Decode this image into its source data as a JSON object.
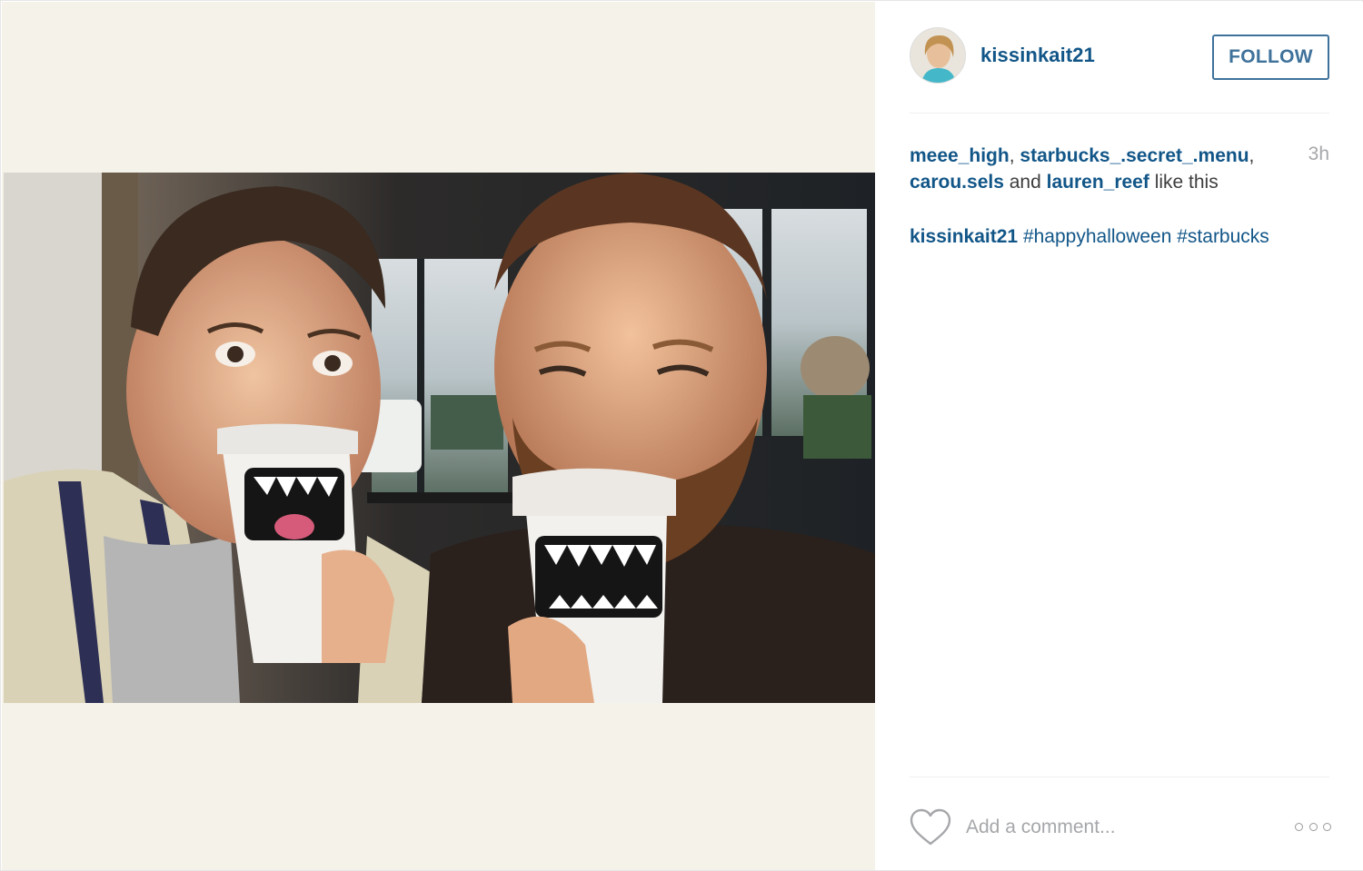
{
  "post": {
    "username": "kissinkait21",
    "follow_label": "FOLLOW",
    "time_ago": "3h",
    "likes": {
      "users": [
        "meee_high",
        "starbucks_.secret_.menu",
        "carou.sels",
        "lauren_reef"
      ],
      "sep1": ", ",
      "sep2": ",",
      "and": " and ",
      "suffix": " like this"
    },
    "caption": {
      "author": "kissinkait21",
      "hashtags": [
        "#happyhalloween",
        "#starbucks"
      ]
    },
    "comment": {
      "placeholder": "Add a comment..."
    }
  },
  "icons": {
    "like": "heart-outline-icon",
    "more": "three-dots-icon"
  },
  "colors": {
    "link": "#125688",
    "follow": "#3f729b",
    "muted": "#a5a7aa",
    "photo_bg": "#f5f2ea"
  }
}
